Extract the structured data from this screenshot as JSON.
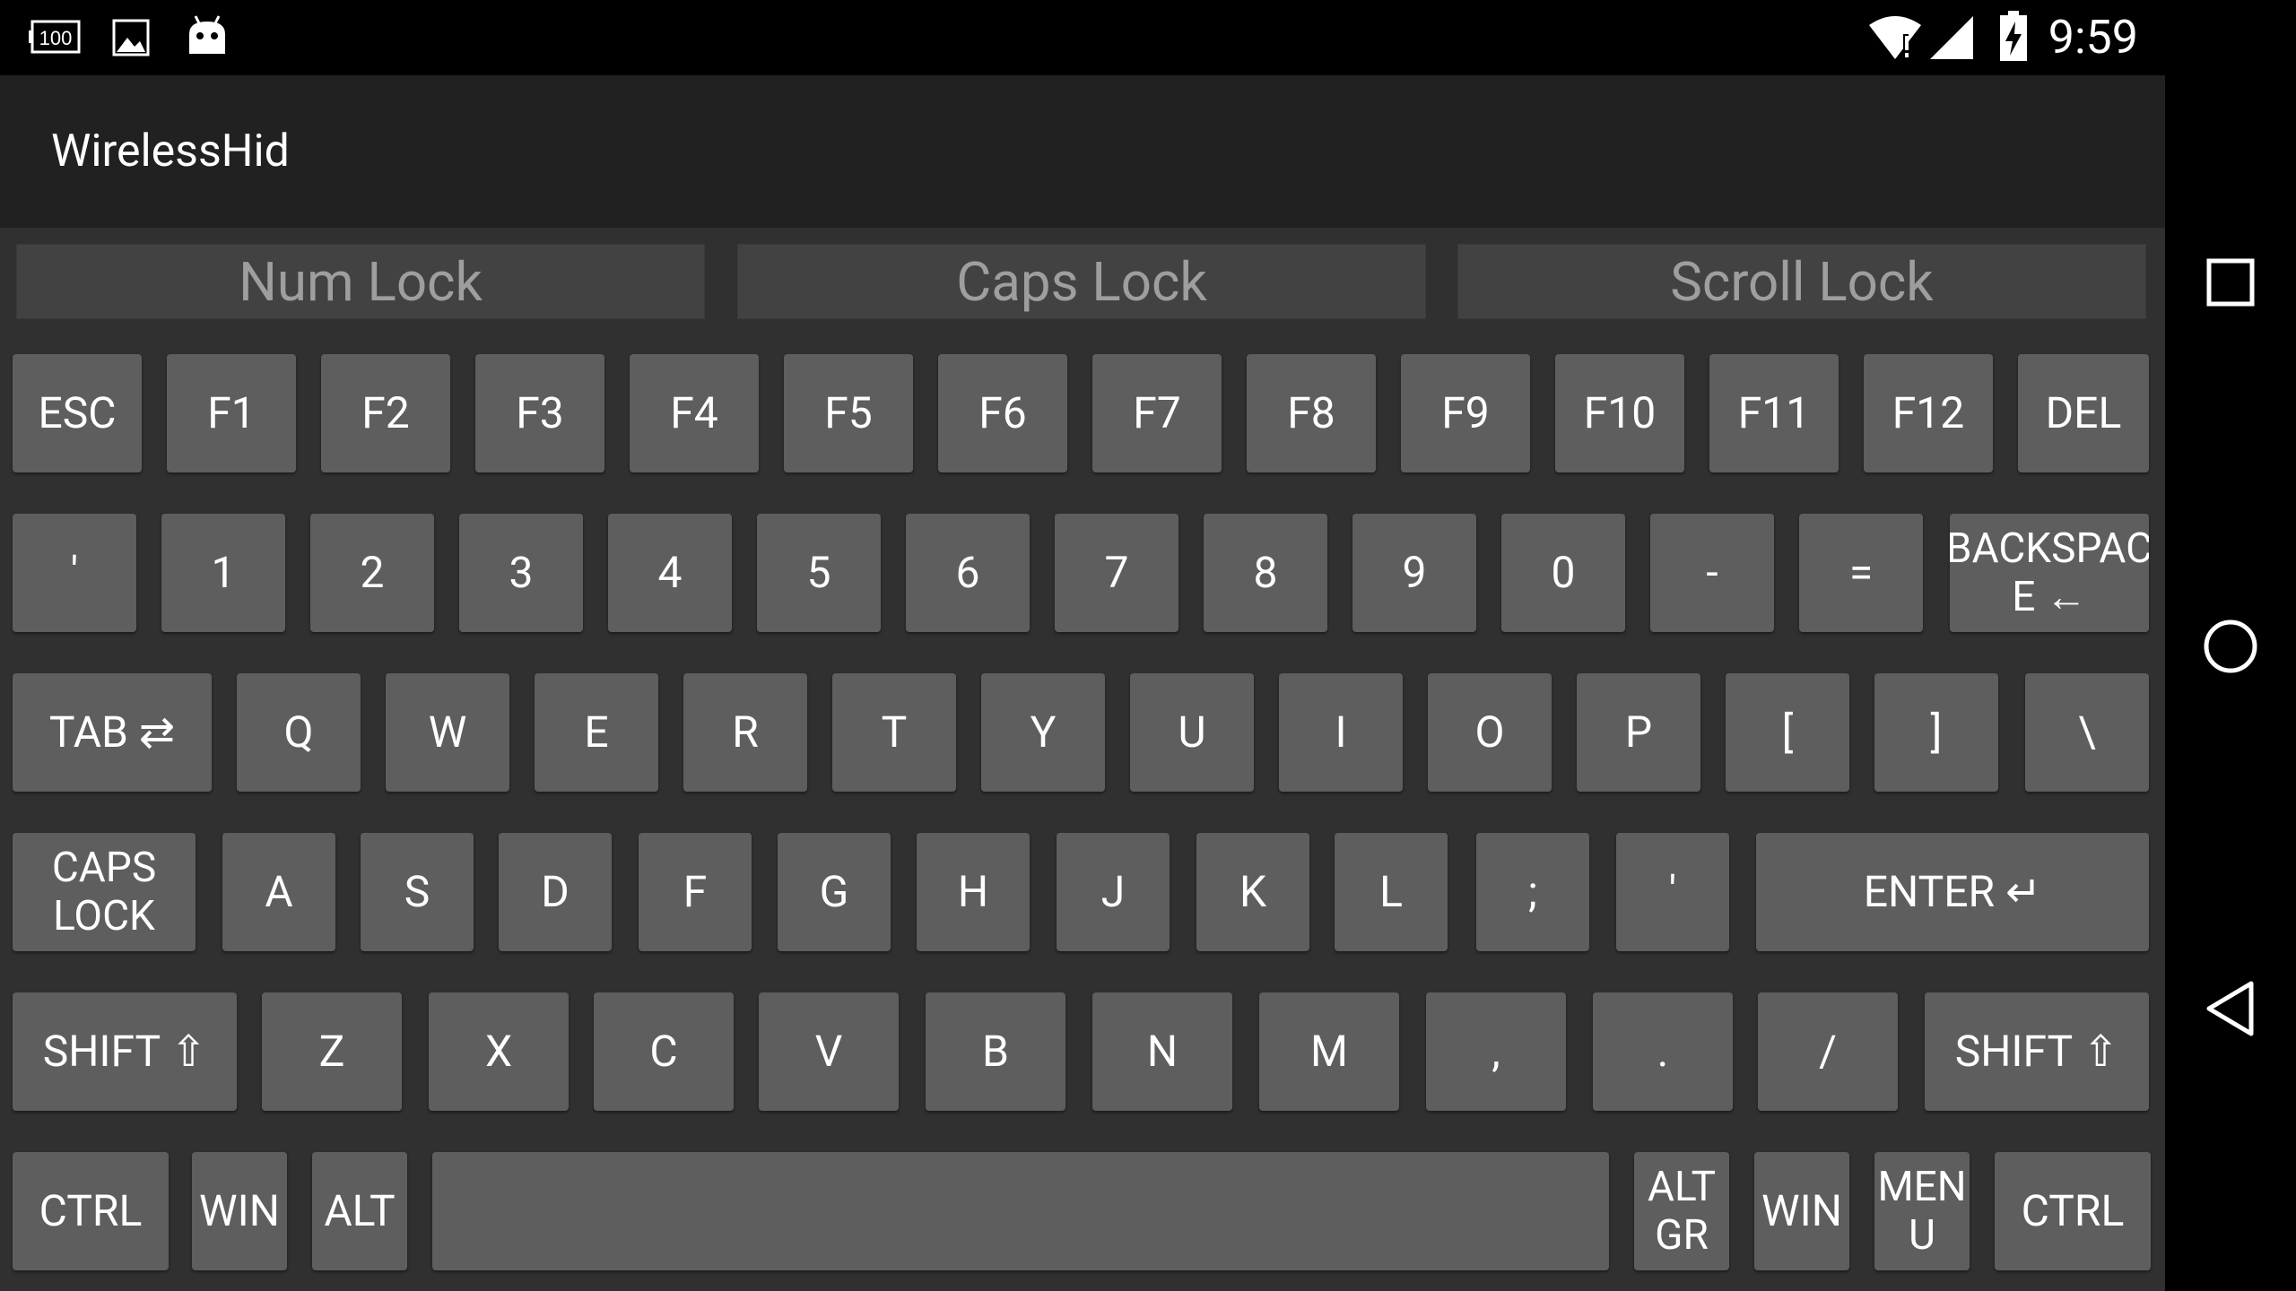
{
  "status_bar": {
    "time": "9:59",
    "left_icons": [
      "battery-100-icon",
      "image-icon",
      "android-icon"
    ],
    "battery_badge": "100",
    "right_icons": [
      "wifi-icon",
      "signal-icon",
      "battery-charging-icon"
    ]
  },
  "app": {
    "title": "WirelessHid"
  },
  "lock_indicators": [
    "Num Lock",
    "Caps Lock",
    "Scroll Lock"
  ],
  "nav_bar": [
    "recents-icon",
    "home-icon",
    "back-icon"
  ],
  "keyboard": {
    "rows": [
      [
        "ESC",
        "F1",
        "F2",
        "F3",
        "F4",
        "F5",
        "F6",
        "F7",
        "F8",
        "F9",
        "F10",
        "F11",
        "F12",
        "DEL"
      ],
      [
        "'",
        "1",
        "2",
        "3",
        "4",
        "5",
        "6",
        "7",
        "8",
        "9",
        "0",
        "-",
        "=",
        "BACKSPAC\nE ←"
      ],
      [
        "TAB ⇄",
        "Q",
        "W",
        "E",
        "R",
        "T",
        "Y",
        "U",
        "I",
        "O",
        "P",
        "[",
        "]",
        "\\"
      ],
      [
        "CAPS\nLOCK",
        "A",
        "S",
        "D",
        "F",
        "G",
        "H",
        "J",
        "K",
        "L",
        ";",
        "'",
        "ENTER ↵"
      ],
      [
        "SHIFT ⇧",
        "Z",
        "X",
        "C",
        "V",
        "B",
        "N",
        "M",
        ",",
        ".",
        "/",
        "SHIFT ⇧"
      ],
      [
        "CTRL",
        "WIN",
        "ALT",
        "",
        "ALT\nGR",
        "WIN",
        "MEN\nU",
        "CTRL"
      ]
    ]
  },
  "colors": {
    "status_bar": "#000000",
    "app_bar": "#212121",
    "background": "#303030",
    "key": "#5e5e5e",
    "lock_indicator": "#424242",
    "lock_text": "#9e9e9e",
    "key_text": "#ffffff"
  }
}
